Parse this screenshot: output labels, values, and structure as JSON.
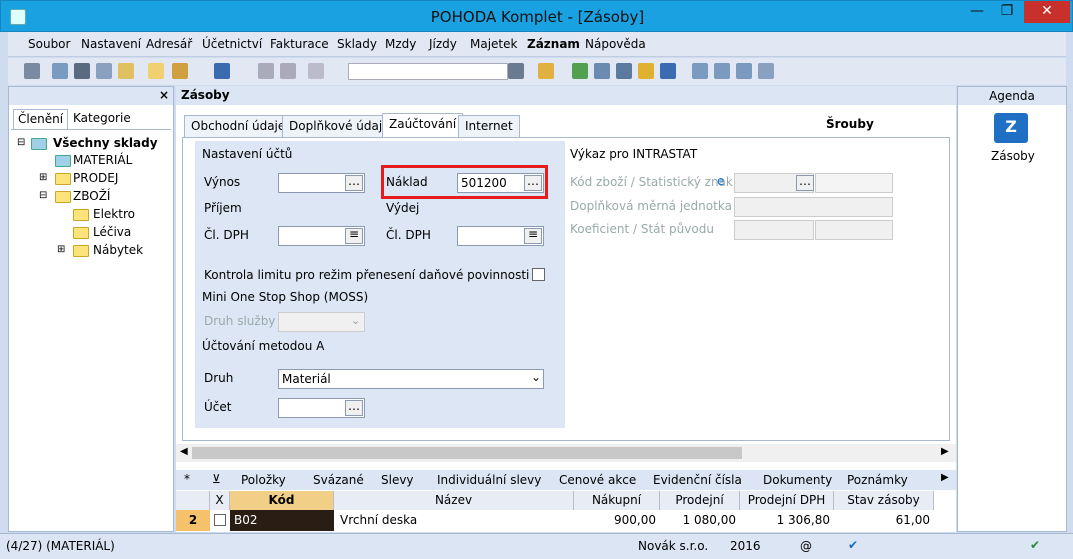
{
  "window": {
    "title": "POHODA Komplet - [Zásoby]"
  },
  "menu": [
    "Soubor",
    "Nastavení",
    "Adresář",
    "Účetnictví",
    "Fakturace",
    "Sklady",
    "Mzdy",
    "Jízdy",
    "Majetek",
    "Záznam",
    "Nápověda"
  ],
  "left": {
    "tabs": [
      "Členění",
      "Kategorie"
    ],
    "tree": [
      "Všechny sklady",
      "MATERIÁL",
      "PRODEJ",
      "ZBOŽÍ",
      "Elektro",
      "Léčiva",
      "Nábytek"
    ]
  },
  "center": {
    "title": "Zásoby",
    "tabs": [
      "Obchodní údaje",
      "Doplňkové údaje",
      "Zaúčtování",
      "Internet"
    ],
    "item_name": "Šrouby",
    "settings_title": "Nastavení účtů",
    "vynos": "Výnos",
    "naklad": "Náklad",
    "naklad_value": "501200",
    "prijem": "Příjem",
    "vydej": "Výdej",
    "cl_dph": "Čl. DPH",
    "cl_dph2": "Čl. DPH",
    "kontrola": "Kontrola limitu pro režim přenesení daňové povinnosti",
    "moss": "Mini One Stop Shop (MOSS)",
    "druh_sluzby": "Druh služby",
    "ucetmetod": "Účtování metodou A",
    "druh": "Druh",
    "druh_value": "Materiál",
    "ucet": "Účet",
    "intrastat": "Výkaz pro INTRASTAT",
    "kod_zbozi": "Kód zboží / Statistický znak",
    "dopl_jednotka": "Doplňková měrná jednotka",
    "koef": "Koeficient / Stát původu"
  },
  "bottom_tabs": [
    "Položky",
    "Svázané",
    "Slevy",
    "Individuální slevy",
    "Cenové akce",
    "Evidenční čísla",
    "Dokumenty",
    "Poznámky"
  ],
  "grid": {
    "headers": [
      "X",
      "Kód",
      "Název",
      "Nákupní",
      "Prodejní",
      "Prodejní DPH",
      "Stav zásoby"
    ],
    "row": {
      "num": "2",
      "kod": "B02",
      "nazev": "Vrchní deska",
      "nakupni": "900,00",
      "prodejni": "1 080,00",
      "prodejni_dph": "1 306,80",
      "stav": "61,00"
    }
  },
  "right": {
    "header": "Agenda",
    "item": "Zásoby"
  },
  "status": {
    "left": "(4/27) (MATERIÁL)",
    "company": "Novák s.r.o.",
    "year": "2016",
    "at": "@"
  }
}
